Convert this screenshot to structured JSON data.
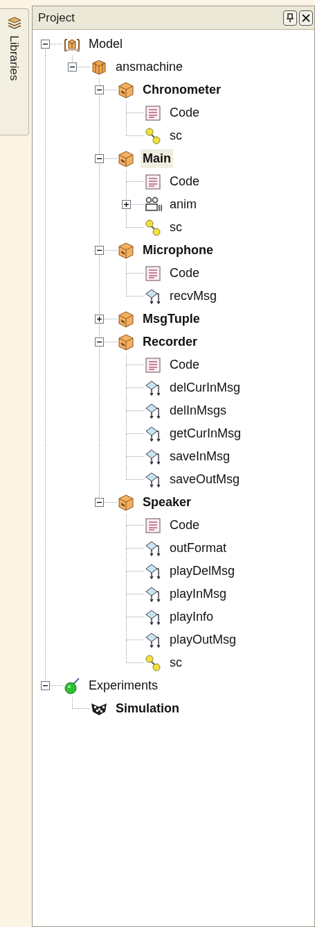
{
  "side_tab": {
    "label": "Libraries"
  },
  "panel": {
    "title": "Project"
  },
  "tree": [
    {
      "kind": "model",
      "label": "Model",
      "expanded": true,
      "selected": false,
      "children": [
        {
          "kind": "package",
          "label": "ansmachine",
          "expanded": true,
          "selected": false,
          "children": [
            {
              "kind": "agent",
              "label": "Chronometer",
              "expanded": true,
              "selected": false,
              "children": [
                {
                  "kind": "code",
                  "label": "Code",
                  "selected": false
                },
                {
                  "kind": "statechart",
                  "label": "sc",
                  "selected": false
                }
              ]
            },
            {
              "kind": "agent",
              "label": "Main",
              "expanded": true,
              "selected": true,
              "children": [
                {
                  "kind": "code",
                  "label": "Code",
                  "selected": false
                },
                {
                  "kind": "animation",
                  "label": "anim",
                  "expanded": false,
                  "selected": false
                },
                {
                  "kind": "statechart",
                  "label": "sc",
                  "selected": false
                }
              ]
            },
            {
              "kind": "agent",
              "label": "Microphone",
              "expanded": true,
              "selected": false,
              "children": [
                {
                  "kind": "code",
                  "label": "Code",
                  "selected": false
                },
                {
                  "kind": "function",
                  "label": "recvMsg",
                  "selected": false
                }
              ]
            },
            {
              "kind": "agent",
              "label": "MsgTuple",
              "expanded": false,
              "selected": false
            },
            {
              "kind": "agent",
              "label": "Recorder",
              "expanded": true,
              "selected": false,
              "children": [
                {
                  "kind": "code",
                  "label": "Code",
                  "selected": false
                },
                {
                  "kind": "function",
                  "label": "delCurInMsg",
                  "selected": false
                },
                {
                  "kind": "function",
                  "label": "delInMsgs",
                  "selected": false
                },
                {
                  "kind": "function",
                  "label": "getCurInMsg",
                  "selected": false
                },
                {
                  "kind": "function",
                  "label": "saveInMsg",
                  "selected": false
                },
                {
                  "kind": "function",
                  "label": "saveOutMsg",
                  "selected": false
                }
              ]
            },
            {
              "kind": "agent",
              "label": "Speaker",
              "expanded": true,
              "selected": false,
              "children": [
                {
                  "kind": "code",
                  "label": "Code",
                  "selected": false
                },
                {
                  "kind": "function",
                  "label": "outFormat",
                  "selected": false
                },
                {
                  "kind": "function",
                  "label": "playDelMsg",
                  "selected": false
                },
                {
                  "kind": "function",
                  "label": "playInMsg",
                  "selected": false
                },
                {
                  "kind": "function",
                  "label": "playInfo",
                  "selected": false
                },
                {
                  "kind": "function",
                  "label": "playOutMsg",
                  "selected": false
                },
                {
                  "kind": "statechart",
                  "label": "sc",
                  "selected": false
                }
              ]
            }
          ]
        }
      ]
    },
    {
      "kind": "experiments",
      "label": "Experiments",
      "expanded": true,
      "selected": false,
      "children": [
        {
          "kind": "simulation",
          "label": "Simulation",
          "selected": false
        }
      ]
    }
  ]
}
